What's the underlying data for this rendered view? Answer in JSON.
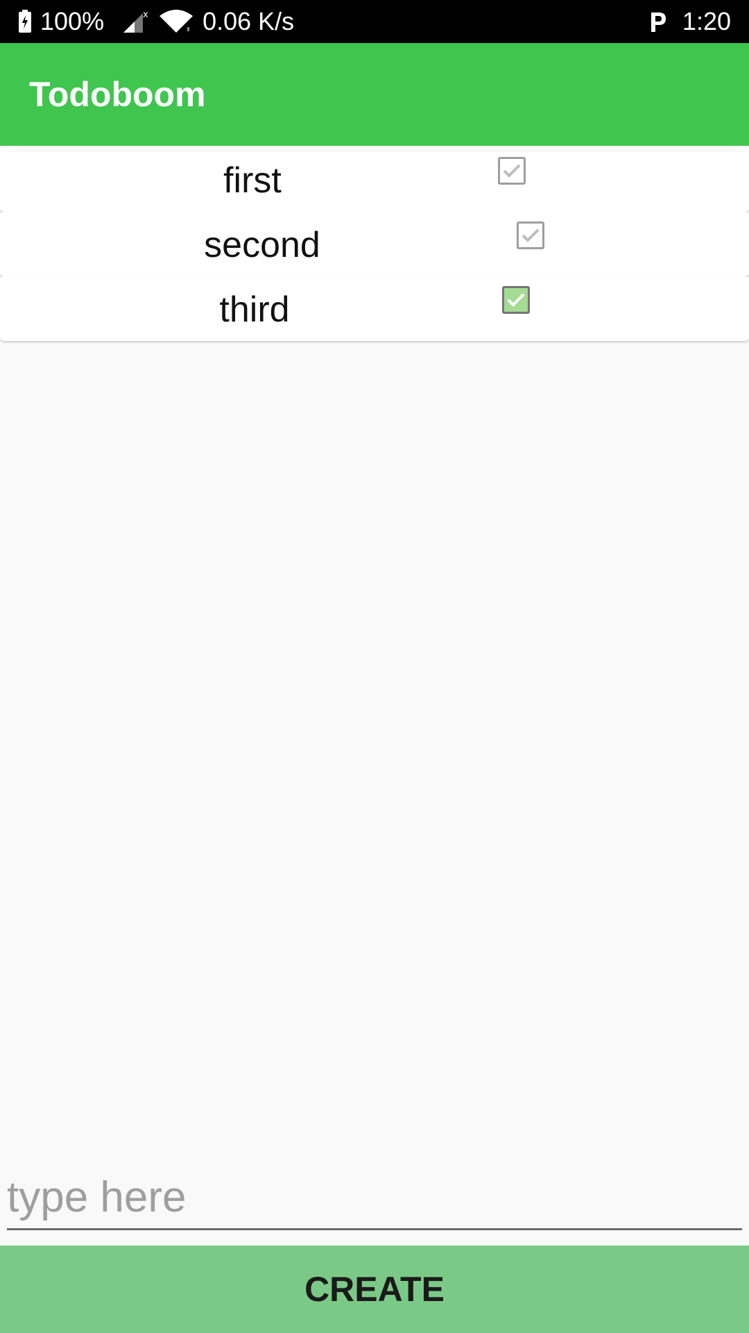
{
  "status_bar": {
    "battery": "100%",
    "net_speed": "0.06 K/s",
    "time": "1:20",
    "icons": [
      "battery-charging-icon",
      "signal-no-service-icon",
      "wifi-icon",
      "parking-icon"
    ]
  },
  "app_bar": {
    "title": "Todoboom"
  },
  "todos": [
    {
      "text": "first",
      "checked": false
    },
    {
      "text": "second",
      "checked": false
    },
    {
      "text": "third",
      "checked": true
    }
  ],
  "input": {
    "placeholder": "type here",
    "value": ""
  },
  "create_button": {
    "label": "CREATE"
  },
  "colors": {
    "app_bar": "#40c54f",
    "create_button": "#7bc986",
    "checked_box": "#a5dc95"
  }
}
